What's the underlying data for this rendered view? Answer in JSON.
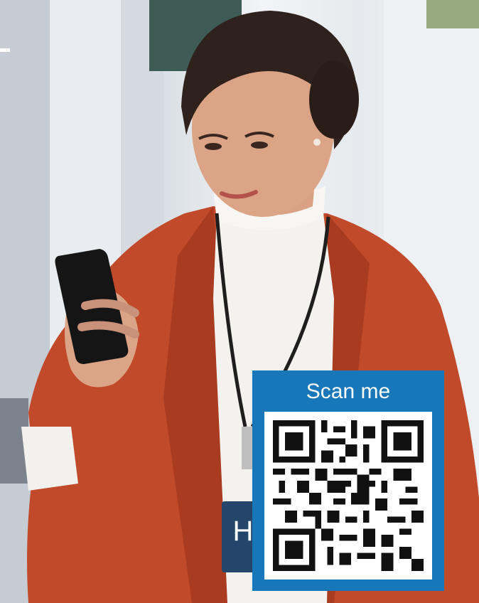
{
  "qr_card": {
    "label": "Scan me",
    "accent_color": "#1877b8"
  },
  "photo": {
    "subject": "woman-with-phone",
    "icon": "lanyard-badge-icon"
  }
}
